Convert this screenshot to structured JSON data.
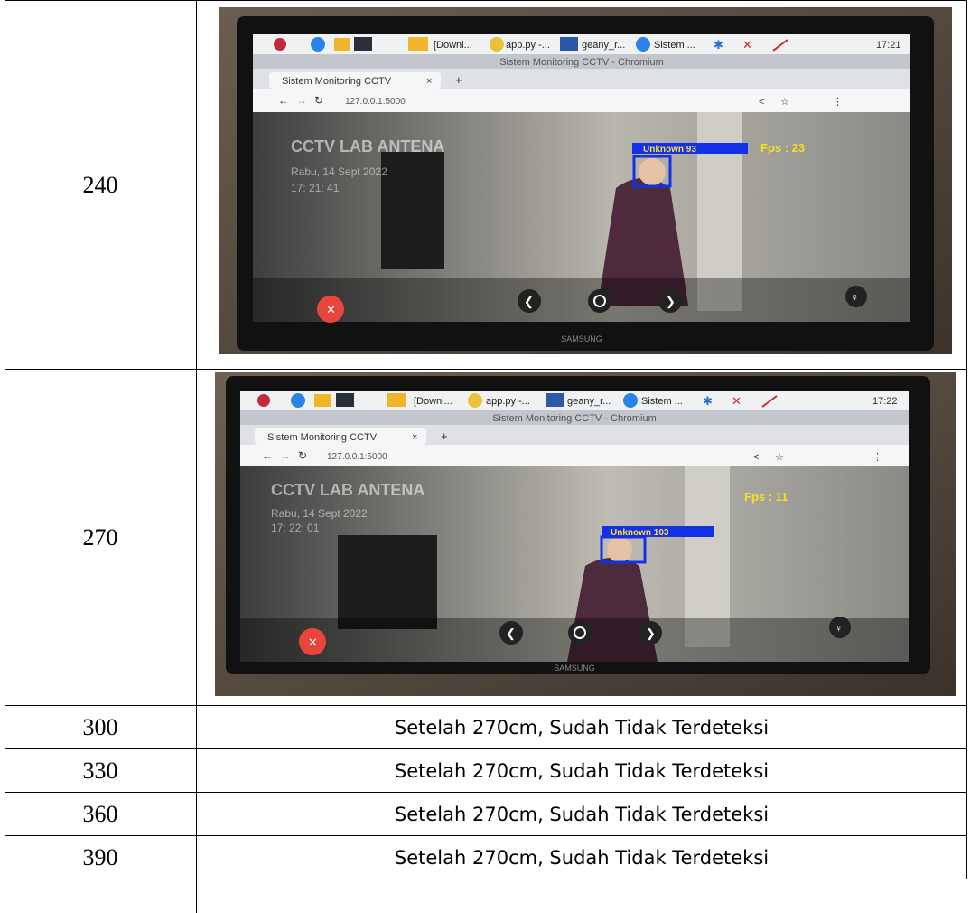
{
  "rows": [
    {
      "distance": "240",
      "photo": {
        "taskbar": {
          "download": "[Downl...",
          "app": "app.py -...",
          "geany": "geany_r...",
          "sistem": "Sistem ...",
          "clock": "17:21"
        },
        "window_title": "Sistem Monitoring CCTV - Chromium",
        "tab_label": "Sistem Monitoring CCTV",
        "tab_close": "×",
        "tab_new": "+",
        "url": "127.0.0.1:5000",
        "overlay_title": "CCTV LAB ANTENA",
        "overlay_date": "Rabu, 14 Sept 2022",
        "overlay_time": "17: 21: 41",
        "face_label": "Unknown 93",
        "fps": "Fps : 23",
        "brand": "SAMSUNG"
      }
    },
    {
      "distance": "270",
      "photo": {
        "taskbar": {
          "download": "[Downl...",
          "app": "app.py -...",
          "geany": "geany_r...",
          "sistem": "Sistem ...",
          "clock": "17:22"
        },
        "window_title": "Sistem Monitoring CCTV - Chromium",
        "tab_label": "Sistem Monitoring CCTV",
        "tab_close": "×",
        "tab_new": "+",
        "url": "127.0.0.1:5000",
        "overlay_title": "CCTV LAB ANTENA",
        "overlay_date": "Rabu, 14 Sept 2022",
        "overlay_time": "17: 22: 01",
        "face_label": "Unknown 103",
        "fps": "Fps : 11",
        "brand": "SAMSUNG"
      }
    },
    {
      "distance": "300",
      "result": "Setelah 270cm, Sudah Tidak Terdeteksi"
    },
    {
      "distance": "330",
      "result": "Setelah 270cm, Sudah Tidak Terdeteksi"
    },
    {
      "distance": "360",
      "result": "Setelah 270cm, Sudah Tidak Terdeteksi"
    },
    {
      "distance": "390",
      "result": "Setelah 270cm, Sudah Tidak Terdeteksi"
    }
  ]
}
